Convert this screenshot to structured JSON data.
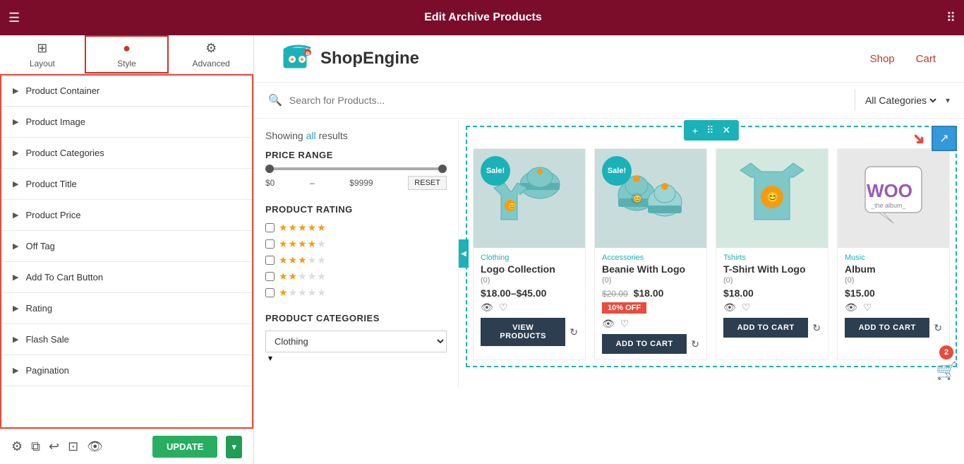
{
  "topBar": {
    "title": "Edit Archive Products",
    "hamburgerIcon": "☰",
    "gridIcon": "⠿"
  },
  "tabs": [
    {
      "id": "layout",
      "label": "Layout",
      "icon": "⊞"
    },
    {
      "id": "style",
      "label": "Style",
      "icon": "●",
      "active": true
    },
    {
      "id": "advanced",
      "label": "Advanced",
      "icon": "⚙"
    }
  ],
  "sidebar": {
    "items": [
      {
        "id": "product-container",
        "label": "Product Container"
      },
      {
        "id": "product-image",
        "label": "Product Image"
      },
      {
        "id": "product-categories",
        "label": "Product Categories"
      },
      {
        "id": "product-title",
        "label": "Product Title"
      },
      {
        "id": "product-price",
        "label": "Product Price"
      },
      {
        "id": "off-tag",
        "label": "Off Tag"
      },
      {
        "id": "add-to-cart-button",
        "label": "Add To Cart Button"
      },
      {
        "id": "rating",
        "label": "Rating"
      },
      {
        "id": "flash-sale",
        "label": "Flash Sale"
      },
      {
        "id": "pagination",
        "label": "Pagination"
      }
    ]
  },
  "header": {
    "logoText": "ShopEngine",
    "navLinks": [
      "Shop",
      "Cart"
    ]
  },
  "search": {
    "placeholder": "Search for Products...",
    "categoryLabel": "All Categories"
  },
  "filter": {
    "showingResults": "Showing all results",
    "showingResultsHighlight": "all",
    "priceRange": {
      "title": "PRICE RANGE",
      "min": "$0",
      "max": "$9999",
      "resetLabel": "RESET"
    },
    "productRating": {
      "title": "PRODUCT RATING",
      "rows": [
        5,
        4,
        3,
        2,
        1
      ]
    },
    "productCategories": {
      "title": "PRODUCT CATEGORIES",
      "placeholder": "Clothing"
    }
  },
  "products": [
    {
      "id": 1,
      "category": "Clothing",
      "name": "Logo Collection",
      "rating": "(0)",
      "price": "$18.00–$45.00",
      "hasSale": true,
      "saleBadge": "Sale!",
      "btnLabel": "VIEW PRODUCTS",
      "hasRefresh": true,
      "color": "#b8d4d4"
    },
    {
      "id": 2,
      "category": "Accessories",
      "name": "Beanie With Logo",
      "rating": "(0)",
      "priceOld": "$20.00",
      "priceNew": "$18.00",
      "offBadge": "10% OFF",
      "hasSale": true,
      "saleBadge": "Sale!",
      "btnLabel": "ADD TO CART",
      "hasRefresh": true,
      "color": "#b8d4d4"
    },
    {
      "id": 3,
      "category": "Tshirts",
      "name": "T-Shirt With Logo",
      "rating": "(0)",
      "price": "$18.00",
      "hasSale": false,
      "btnLabel": "ADD TO CART",
      "hasRefresh": true,
      "color": "#c8e0d8"
    },
    {
      "id": 4,
      "category": "Music",
      "name": "Album",
      "rating": "(0)",
      "price": "$15.00",
      "hasSale": false,
      "btnLabel": "ADD TO CART",
      "hasRefresh": true,
      "color": "#e8e8e8"
    }
  ],
  "bottomBar": {
    "updateLabel": "UPDATE",
    "icons": [
      "⚙",
      "⧉",
      "↩",
      "⊡",
      "👁"
    ]
  },
  "cart": {
    "badge": "2",
    "icon": "🛒"
  },
  "widgetToolbar": {
    "addIcon": "+",
    "moveIcon": "⠿",
    "closeIcon": "✕"
  }
}
